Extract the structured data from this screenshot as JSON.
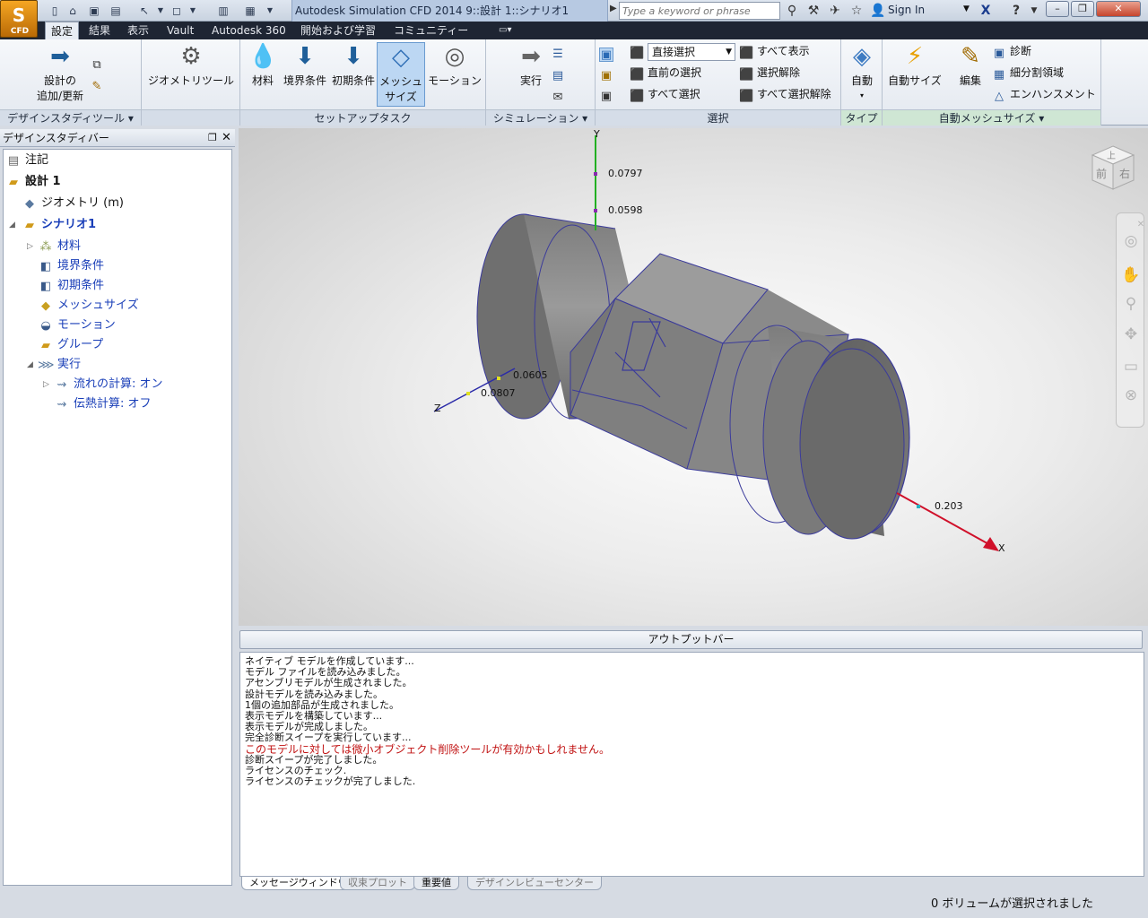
{
  "app": {
    "logo_label": "CFD",
    "window_title": "Autodesk Simulation CFD 2014   9::設計 1::シナリオ1",
    "search_placeholder": "Type a keyword or phrase",
    "sign_in": "Sign In"
  },
  "ribbon_tabs": [
    "設定",
    "結果",
    "表示",
    "Vault",
    "Autodesk 360",
    "開始および学習",
    "コミュニティー"
  ],
  "ribbon": {
    "design_study_tools": {
      "label": "デザインスタディツール",
      "update_line1": "設計の",
      "update_line2": "追加/更新"
    },
    "geometry": {
      "tool": "ジオメトリツール"
    },
    "setup_tasks": {
      "label": "セットアップタスク",
      "material": "材料",
      "boundary": "境界条件",
      "initial": "初期条件",
      "mesh_line1": "メッシュ",
      "mesh_line2": "サイズ",
      "motion": "モーション"
    },
    "simulation": {
      "label": "シミュレーション",
      "run": "実行"
    },
    "selection": {
      "label": "選択",
      "mode": "直接選択",
      "previous": "直前の選択",
      "select_all": "すべて選択",
      "show_all": "すべて表示",
      "deselect": "選択解除",
      "deselect_all": "すべて選択解除"
    },
    "type": {
      "label": "タイプ",
      "auto": "自動"
    },
    "auto_mesh": {
      "label": "自動メッシュサイズ",
      "autosize": "自動サイズ",
      "edit": "編集",
      "diagnose": "診断",
      "refine": "細分割領域",
      "enhance": "エンハンスメント"
    }
  },
  "design_study_bar": {
    "title": "デザインスタディバー",
    "tree": [
      {
        "label": "注記",
        "icon": "notes-icon"
      },
      {
        "label": "設計 1",
        "icon": "design-folder-icon"
      },
      {
        "label": "ジオメトリ (m)",
        "icon": "geometry-icon"
      },
      {
        "label": "シナリオ1",
        "icon": "scenario-icon"
      },
      {
        "label": "材料",
        "icon": "materials-icon"
      },
      {
        "label": "境界条件",
        "icon": "boundary-conditions-icon"
      },
      {
        "label": "初期条件",
        "icon": "initial-conditions-icon"
      },
      {
        "label": "メッシュサイズ",
        "icon": "mesh-size-icon"
      },
      {
        "label": "モーション",
        "icon": "motion-icon"
      },
      {
        "label": "グループ",
        "icon": "groups-icon"
      },
      {
        "label": "実行",
        "icon": "run-icon"
      },
      {
        "label": "流れの計算: オン",
        "icon": "flow-icon"
      },
      {
        "label": "伝熱計算: オフ",
        "icon": "heat-icon"
      }
    ]
  },
  "viewport": {
    "axis_labels": {
      "x": "X",
      "y": "Y",
      "z": "Z"
    },
    "ticks": {
      "y1": "0.0797",
      "y2": "0.0598",
      "z1": "0.0605",
      "z2": "0.0807",
      "x1": "0.203"
    },
    "viewcube": {
      "top": "上",
      "front": "前",
      "right": "右"
    },
    "colors": {
      "x_axis": "#d0102a",
      "y_axis": "#22b022",
      "z_axis": "#2a2aa8",
      "model": "#8a8a8a"
    }
  },
  "output": {
    "title": "アウトプットバー",
    "lines": [
      {
        "text": "ネイティブ モデルを作成しています...",
        "warn": false
      },
      {
        "text": "モデル ファイルを読み込みました。",
        "warn": false
      },
      {
        "text": "アセンブリモデルが生成されました。",
        "warn": false
      },
      {
        "text": "設計モデルを読み込みました。",
        "warn": false
      },
      {
        "text": "1個の追加部品が生成されました。",
        "warn": false
      },
      {
        "text": "表示モデルを構築しています...",
        "warn": false
      },
      {
        "text": "表示モデルが完成しました。",
        "warn": false
      },
      {
        "text": "完全診断スイープを実行しています...",
        "warn": false
      },
      {
        "text": "このモデルに対しては微小オブジェクト削除ツールが有効かもしれません。",
        "warn": true
      },
      {
        "text": "診断スイープが完了しました。",
        "warn": false
      },
      {
        "text": "ライセンスのチェック.",
        "warn": false
      },
      {
        "text": "ライセンスのチェックが完了しました.",
        "warn": false
      }
    ],
    "tabs": [
      "メッセージウィンドウ",
      "収束プロット",
      "重要値",
      "デザインレビューセンター"
    ]
  },
  "status": "0 ボリュームが選択されました"
}
